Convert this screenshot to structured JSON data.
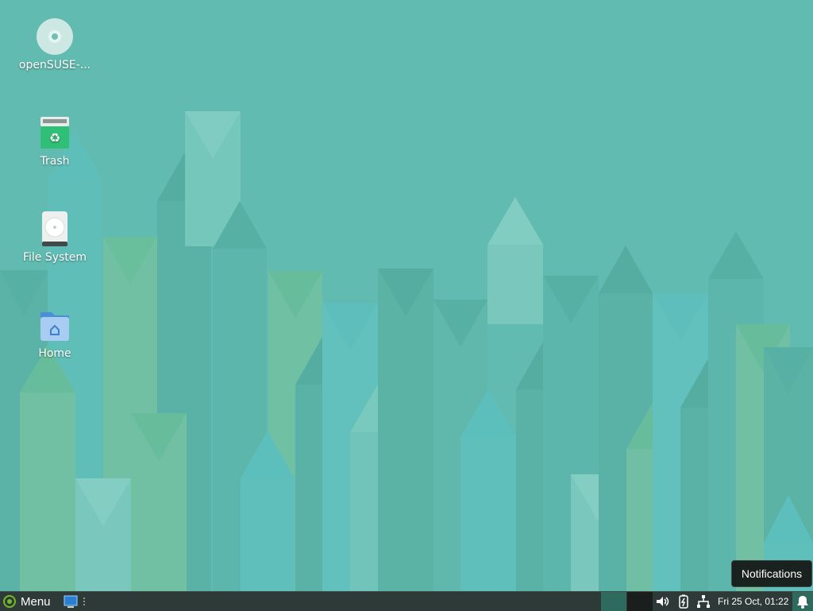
{
  "desktop": {
    "icons": [
      {
        "label": "openSUSE-...",
        "icon": "disc-icon"
      },
      {
        "label": "Trash",
        "icon": "trash-icon"
      },
      {
        "label": "File System",
        "icon": "hard-drive-icon"
      },
      {
        "label": "Home",
        "icon": "home-folder-icon"
      }
    ]
  },
  "taskbar": {
    "menu_label": "Menu",
    "clock": "Fri 25 Oct, 01:22"
  },
  "tooltip": {
    "text": "Notifications"
  },
  "colors": {
    "wallpaper_base": "#62bbb0",
    "taskbar_bg": "#2e3a37",
    "workspace_active": "#2f6a5f",
    "accent_green": "#73ba25"
  }
}
